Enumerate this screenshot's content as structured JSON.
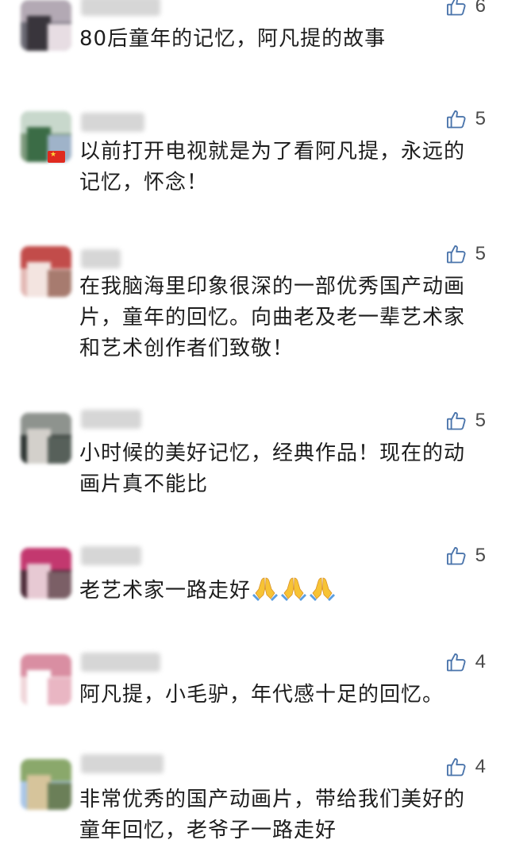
{
  "comments": [
    {
      "username": "",
      "text": "80后童年的记忆，阿凡提的故事",
      "likes": "6",
      "avatar_colors": [
        "#6b6a74",
        "#b3a9b4",
        "#39353c",
        "#e7dde3"
      ]
    },
    {
      "username": "",
      "text": "以前打开电视就是为了看阿凡提，永远的记忆，怀念！",
      "likes": "5",
      "avatar_colors": [
        "#7d9a7c",
        "#c8d8cc",
        "#3b6c46",
        "#9fb3c9"
      ],
      "flag": "china-flag-icon"
    },
    {
      "username": "",
      "text": "在我脑海里印象很深的一部优秀国产动画片，童年的回忆。向曲老及老一辈艺术家和艺术创作者们致敬！",
      "likes": "5",
      "avatar_colors": [
        "#e3b9b5",
        "#c24c4a",
        "#f3e4e0",
        "#a77b6f"
      ]
    },
    {
      "username": "",
      "text": "小时候的美好记忆，经典作品！现在的动画片真不能比",
      "likes": "5",
      "avatar_colors": [
        "#2c3330",
        "#8e938e",
        "#d3d0cb",
        "#57605a"
      ]
    },
    {
      "username": "",
      "text": "老艺术家一路走好",
      "likes": "5",
      "avatar_colors": [
        "#4b2a37",
        "#c3386f",
        "#e7c9d3",
        "#7b5f66"
      ],
      "emoji_count": 3
    },
    {
      "username": "",
      "text": "阿凡提，小毛驴，年代感十足的回忆。",
      "likes": "4",
      "avatar_colors": [
        "#f0d6da",
        "#d98ea2",
        "#ffffff",
        "#e9b6c3"
      ]
    },
    {
      "username": "",
      "text": "非常优秀的国产动画片，带给我们美好的童年回忆，老爷子一路走好",
      "likes": "4",
      "avatar_colors": [
        "#a9c6e7",
        "#8aa86b",
        "#d6c49b",
        "#6b7f58"
      ]
    }
  ],
  "colors": {
    "like_icon": "#4a74ab",
    "text": "#1d1d1d",
    "count": "#4a4a4a"
  }
}
